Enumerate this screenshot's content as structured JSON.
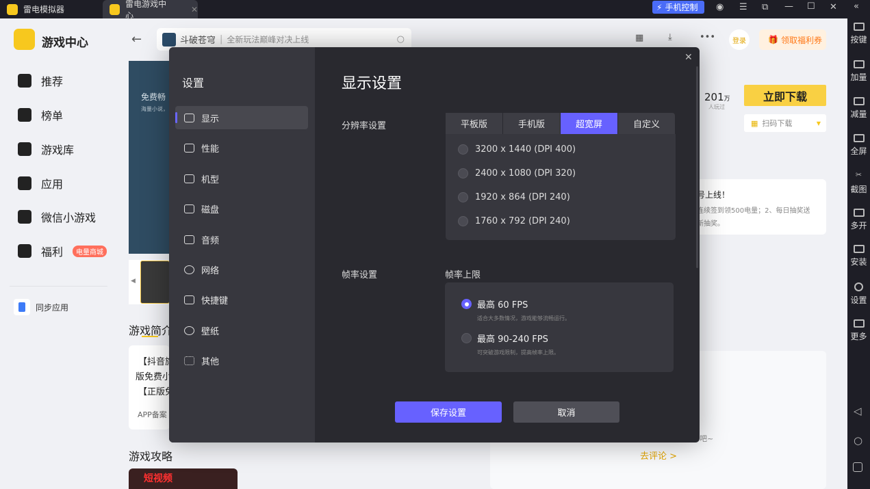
{
  "titlebar": {
    "tabs": [
      {
        "label": "雷电模拟器"
      },
      {
        "label": "雷电游戏中心"
      }
    ],
    "phone_control": "手机控制"
  },
  "app": {
    "title": "游戏中心",
    "search_game": "斗破苍穹",
    "search_placeholder": "全新玩法巅峰对决上线",
    "login": "登录",
    "coupon": "领取福利券"
  },
  "sidebar": {
    "items": [
      {
        "label": "推荐"
      },
      {
        "label": "榜单"
      },
      {
        "label": "游戏库"
      },
      {
        "label": "应用"
      },
      {
        "label": "微信小游戏"
      },
      {
        "label": "福利",
        "badge": "电量商城"
      }
    ],
    "sync": "同步应用"
  },
  "game": {
    "players": "201",
    "players_unit": "万",
    "players_label": "人玩过",
    "download": "立即下载",
    "qr_download": "扫码下载",
    "intro_title": "游戏简介",
    "intro_lines": [
      "【抖音旗",
      "版免费小",
      "【正版免"
    ],
    "app_record": "APP备案",
    "guide_title": "游戏攻略",
    "guide_thumb": "短视频",
    "notice_title": "号上线！",
    "notice_line1": "连续签到领500电量；2、每日抽奖送",
    "notice_line2": "新抽奖。",
    "comment_hint": "吧~",
    "comment_link": "去评论 >",
    "banner_title": "免费畅",
    "banner_sub": "海量小说，"
  },
  "right_toolbar": [
    {
      "label": "按键"
    },
    {
      "label": "加量"
    },
    {
      "label": "减量"
    },
    {
      "label": "全屏"
    },
    {
      "label": "截图"
    },
    {
      "label": "多开"
    },
    {
      "label": "安装"
    },
    {
      "label": "设置"
    },
    {
      "label": "更多"
    }
  ],
  "settings": {
    "title": "设置",
    "nav": [
      {
        "label": "显示"
      },
      {
        "label": "性能"
      },
      {
        "label": "机型"
      },
      {
        "label": "磁盘"
      },
      {
        "label": "音频"
      },
      {
        "label": "网络"
      },
      {
        "label": "快捷键"
      },
      {
        "label": "壁纸"
      },
      {
        "label": "其他"
      }
    ],
    "heading": "显示设置",
    "resolution_label": "分辨率设置",
    "resolution_tabs": [
      {
        "label": "平板版"
      },
      {
        "label": "手机版"
      },
      {
        "label": "超宽屏"
      },
      {
        "label": "自定义"
      }
    ],
    "resolution_active": "超宽屏",
    "resolutions": [
      {
        "label": "3200 x 1440  (DPI 400)"
      },
      {
        "label": "2400 x 1080  (DPI 320)"
      },
      {
        "label": "1920 x 864  (DPI 240)"
      },
      {
        "label": "1760 x 792  (DPI 240)"
      }
    ],
    "fps_label": "帧率设置",
    "fps_limit_label": "帧率上限",
    "fps_options": [
      {
        "label": "最高 60 FPS",
        "desc": "适合大多数情况，游戏能够流畅运行。",
        "selected": true
      },
      {
        "label": "最高 90-240 FPS",
        "desc": "可突破游戏限制，提高帧率上限。",
        "selected": false
      }
    ],
    "save": "保存设置",
    "cancel": "取消"
  },
  "colors": {
    "accent": "#6761ff",
    "brand_yellow": "#f7c81e",
    "download_btn": "#f9d043"
  }
}
